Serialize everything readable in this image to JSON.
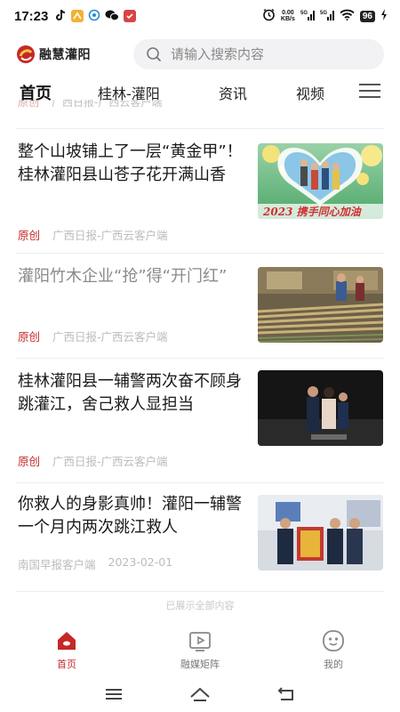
{
  "status_bar": {
    "time": "17:23",
    "net_speed_value": "0.00",
    "net_speed_unit": "KB/s",
    "battery": "96"
  },
  "header": {
    "logo_text": "融慧灌阳",
    "search_placeholder": "请输入搜索内容"
  },
  "tabs": [
    {
      "label": "首页",
      "active": true
    },
    {
      "label": "桂林-灌阳",
      "active": false
    },
    {
      "label": "资讯",
      "active": false
    },
    {
      "label": "视频",
      "active": false
    }
  ],
  "feed": {
    "partial_row": {
      "tag": "原创",
      "source": "广西日报-广西云客户端"
    },
    "articles": [
      {
        "title": "整个山坡铺上了一层“黄金甲”！桂林灌阳县山苍子花开满山香",
        "tag": "原创",
        "source": "广西日报-广西云客户端",
        "date": "",
        "read": false,
        "thumb_caption": "2023 携手同心加油"
      },
      {
        "title": "灌阳竹木企业“抢”得“开门红”",
        "tag": "原创",
        "source": "广西日报-广西云客户端",
        "date": "",
        "read": true
      },
      {
        "title": "桂林灌阳县一辅警两次奋不顾身跳灌江，舍己救人显担当",
        "tag": "原创",
        "source": "广西日报-广西云客户端",
        "date": "",
        "read": false
      },
      {
        "title": "你救人的身影真帅！灌阳一辅警一个月内两次跳江救人",
        "tag": "",
        "source": "南国早报客户端",
        "date": "2023-02-01",
        "read": false
      }
    ],
    "end_note": "已展示全部内容"
  },
  "bottom_nav": [
    {
      "label": "首页",
      "icon": "home-icon",
      "active": true
    },
    {
      "label": "融媒矩阵",
      "icon": "video-play-icon",
      "active": false
    },
    {
      "label": "我的",
      "icon": "smiley-icon",
      "active": false
    }
  ],
  "colors": {
    "accent": "#c62828",
    "tab_text": "#222222",
    "read_title": "#8a8a8a",
    "meta_source": "#bcbcbc"
  }
}
